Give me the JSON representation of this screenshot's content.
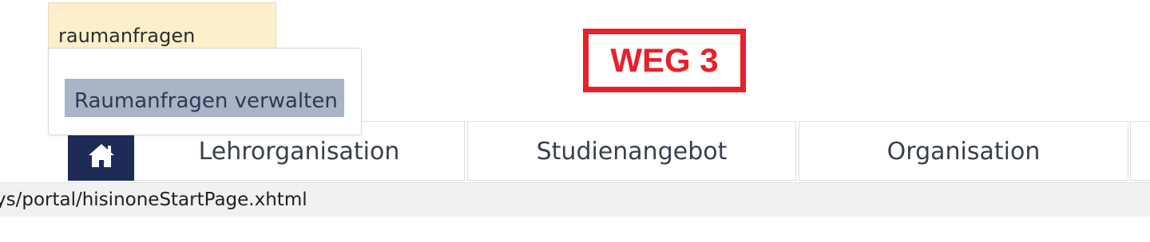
{
  "search": {
    "value": "raumanfragen"
  },
  "suggestions": {
    "items": [
      "Raumanfragen verwalten"
    ]
  },
  "annotation": {
    "label": "WEG 3",
    "color": "#e8202a"
  },
  "nav": {
    "home_icon": "home-icon",
    "tabs": [
      "Lehrorganisation",
      "Studienangebot",
      "Organisation"
    ]
  },
  "status_bar": {
    "url": "ys/portal/hisinoneStartPage.xhtml"
  },
  "colors": {
    "home_bg": "#1f2b57",
    "search_bg": "#fdefc9",
    "suggestion_highlight": "#a9b4c7"
  }
}
